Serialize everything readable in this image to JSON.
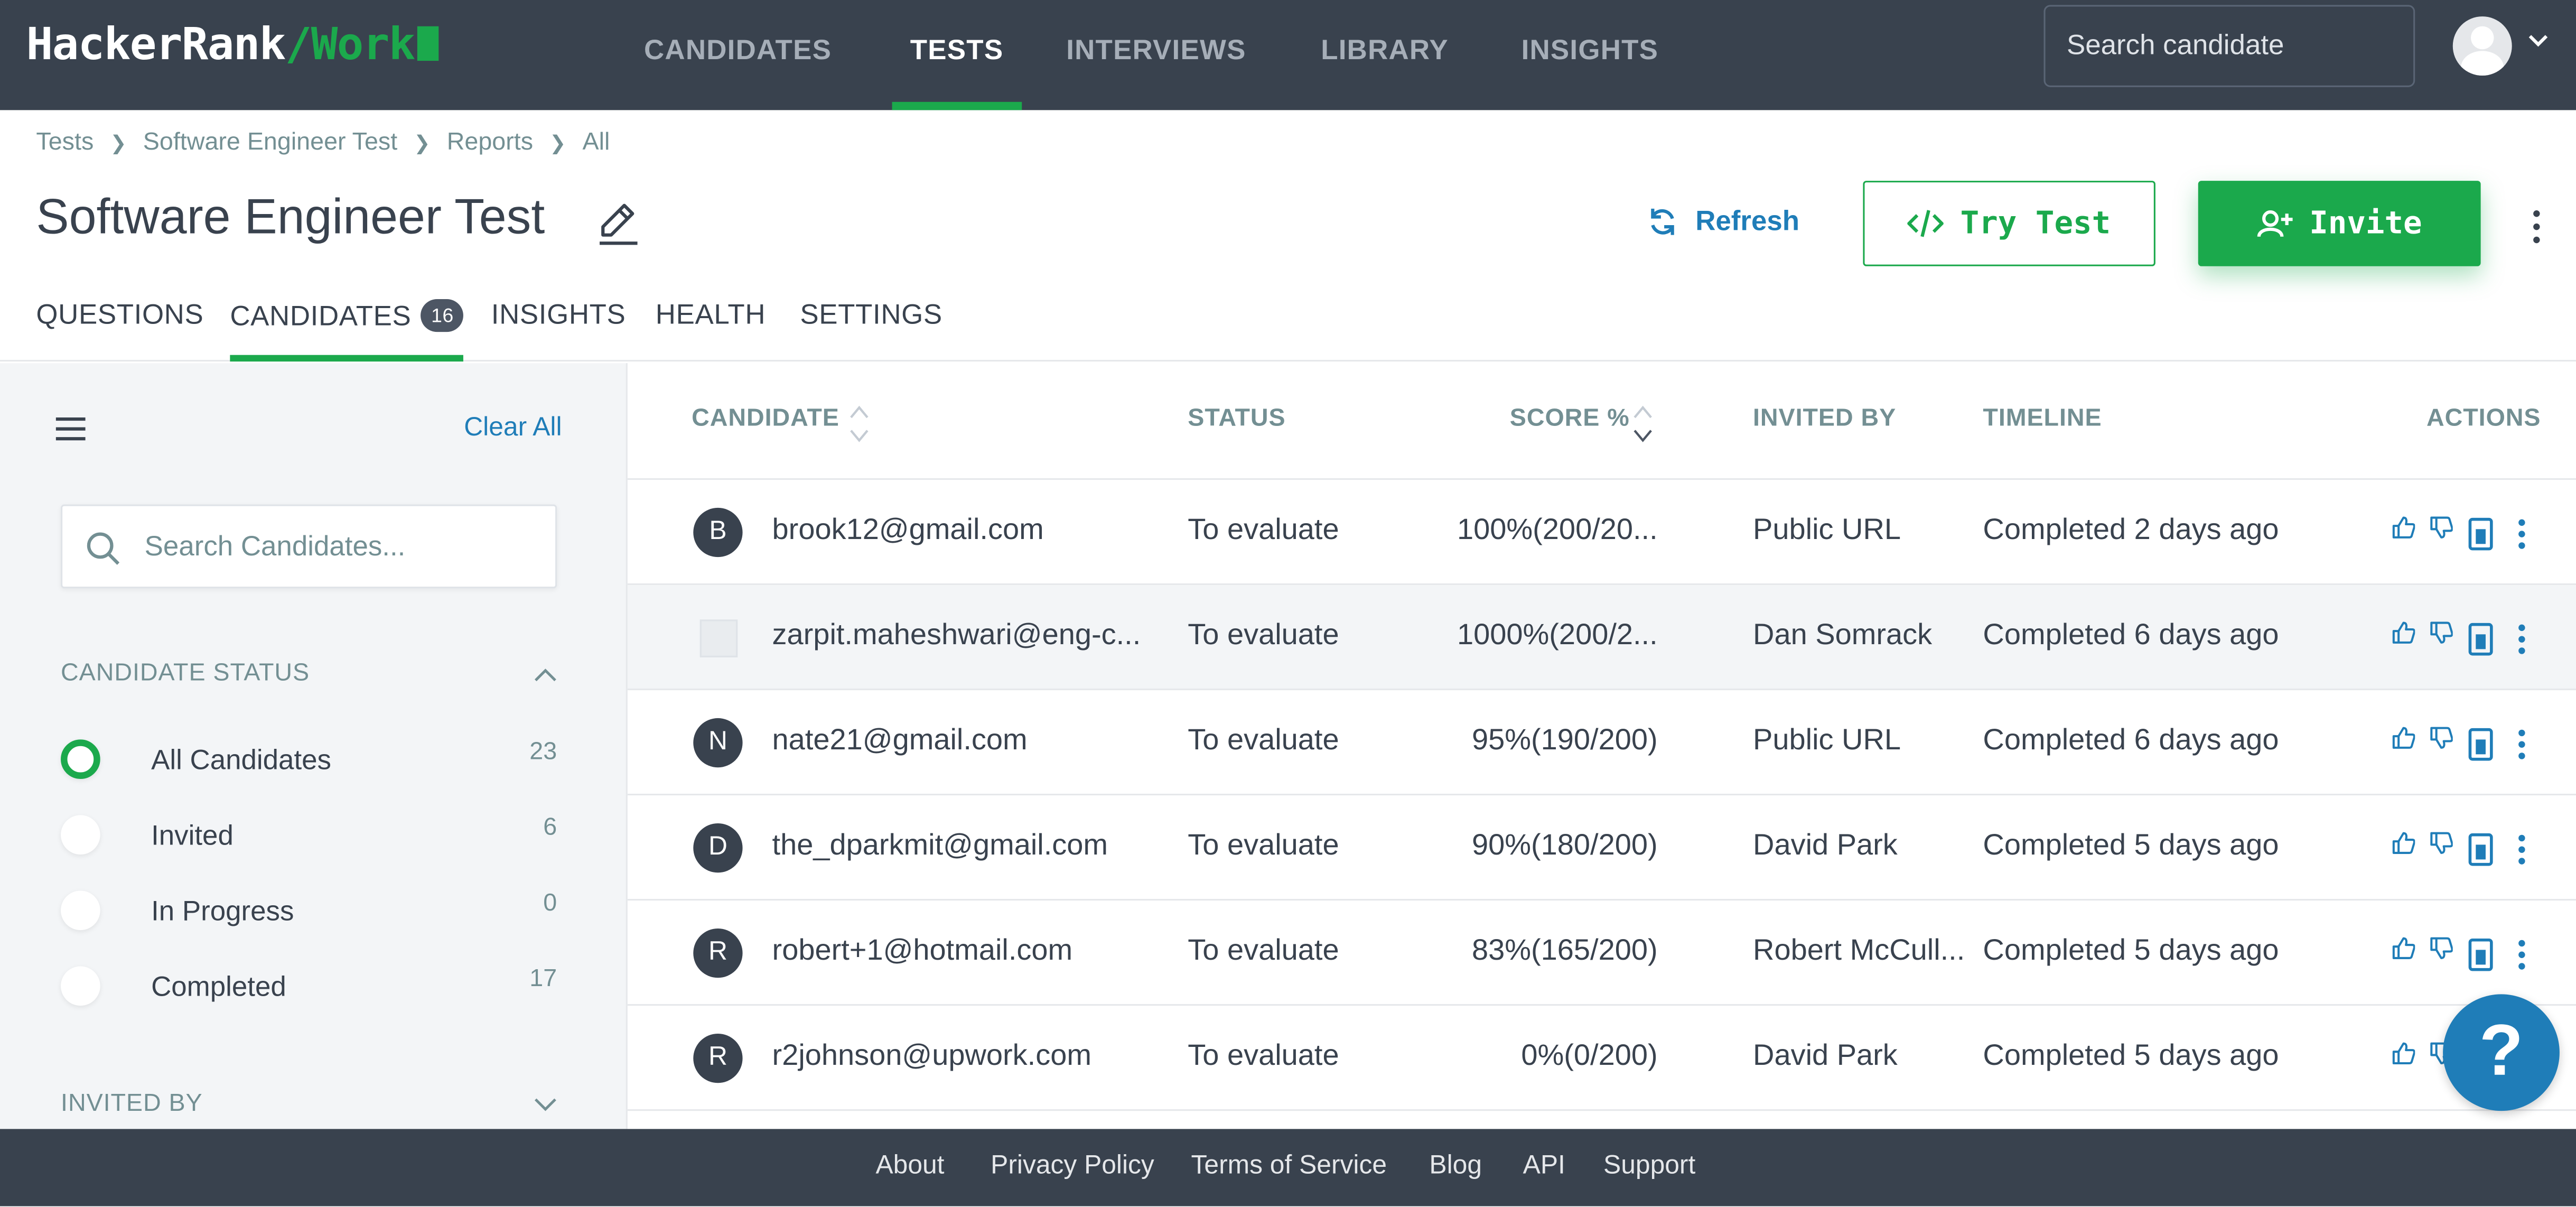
{
  "brand": {
    "name": "HackerRank",
    "slash": "/",
    "product": "Work",
    "accent": "#1ba94c",
    "nav_bg": "#39424e"
  },
  "topnav": {
    "items": [
      {
        "label": "CANDIDATES",
        "active": false
      },
      {
        "label": "TESTS",
        "active": true
      },
      {
        "label": "INTERVIEWS",
        "active": false
      },
      {
        "label": "LIBRARY",
        "active": false
      },
      {
        "label": "INSIGHTS",
        "active": false
      }
    ],
    "search_placeholder": "Search candidate",
    "avatar_icon": "user-avatar-icon",
    "caret_icon": "chevron-down-icon"
  },
  "breadcrumb": [
    "Tests",
    "Software Engineer Test",
    "Reports",
    "All"
  ],
  "page": {
    "title": "Software Engineer Test",
    "refresh_label": "Refresh",
    "try_test_label": "Try Test",
    "invite_label": "Invite"
  },
  "tabs": [
    {
      "label": "QUESTIONS",
      "active": false
    },
    {
      "label": "CANDIDATES",
      "badge": "16",
      "active": true
    },
    {
      "label": "INSIGHTS",
      "active": false
    },
    {
      "label": "HEALTH",
      "active": false
    },
    {
      "label": "SETTINGS",
      "active": false
    }
  ],
  "sidebar": {
    "clear_all": "Clear All",
    "search_placeholder": "Search Candidates...",
    "status_heading": "CANDIDATE STATUS",
    "status_options": [
      {
        "label": "All Candidates",
        "count": "23",
        "checked": true
      },
      {
        "label": "Invited",
        "count": "6",
        "checked": false
      },
      {
        "label": "In Progress",
        "count": "0",
        "checked": false
      },
      {
        "label": "Completed",
        "count": "17",
        "checked": false
      }
    ],
    "invited_by_heading": "INVITED BY"
  },
  "table": {
    "headers": {
      "candidate": "CANDIDATE",
      "status": "STATUS",
      "score": "SCORE %",
      "invited_by": "INVITED BY",
      "timeline": "TIMELINE",
      "actions": "ACTIONS"
    },
    "rows": [
      {
        "initial": "B",
        "email": "brook12@gmail.com",
        "status": "To evaluate",
        "score": "100%(200/20...",
        "invited_by": "Public URL",
        "timeline": "Completed 2 days ago"
      },
      {
        "initial": "",
        "email": "zarpit.maheshwari@eng-c...",
        "status": "To evaluate",
        "score": "1000%(200/2...",
        "invited_by": "Dan Somrack",
        "timeline": "Completed 6 days ago"
      },
      {
        "initial": "N",
        "email": "nate21@gmail.com",
        "status": "To evaluate",
        "score": "95%(190/200)",
        "invited_by": "Public URL",
        "timeline": "Completed 6 days ago"
      },
      {
        "initial": "D",
        "email": "the_dparkmit@gmail.com",
        "status": "To evaluate",
        "score": "90%(180/200)",
        "invited_by": "David Park",
        "timeline": "Completed 5 days ago"
      },
      {
        "initial": "R",
        "email": "robert+1@hotmail.com",
        "status": "To evaluate",
        "score": "83%(165/200)",
        "invited_by": "Robert McCull...",
        "timeline": "Completed 5 days ago"
      },
      {
        "initial": "R",
        "email": "r2johnson@upwork.com",
        "status": "To evaluate",
        "score": "0%(0/200)",
        "invited_by": "David Park",
        "timeline": "Completed 5 days ago"
      }
    ]
  },
  "help_label": "?",
  "footer": [
    "About",
    "Privacy Policy",
    "Terms of Service",
    "Blog",
    "API",
    "Support"
  ]
}
